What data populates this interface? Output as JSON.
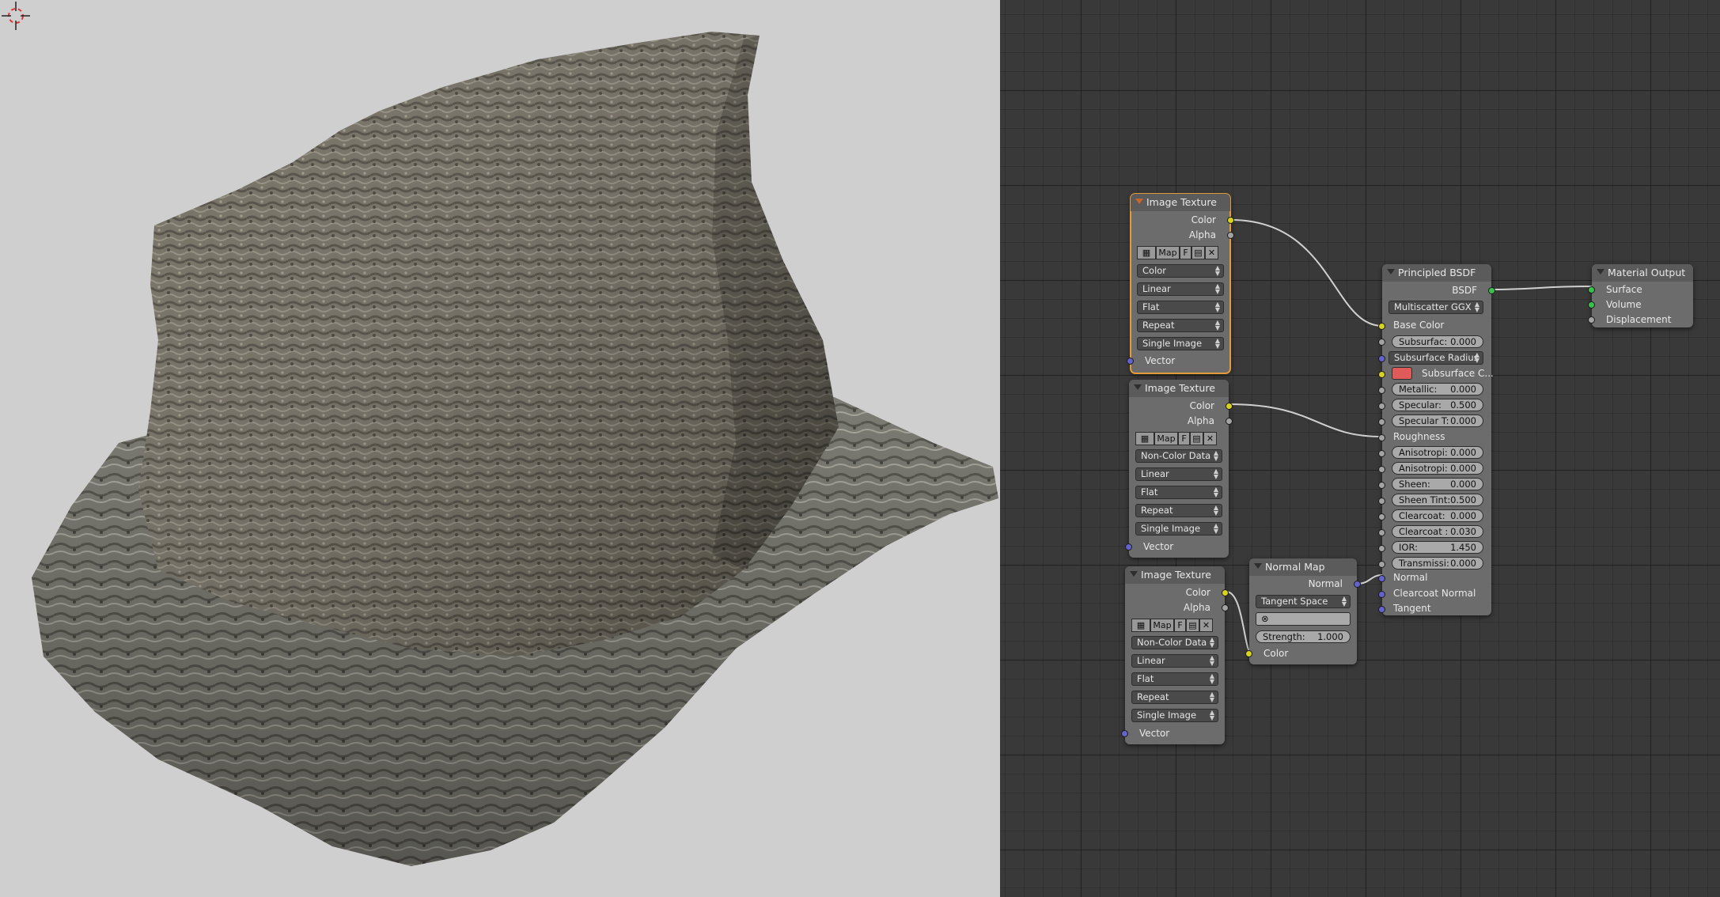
{
  "colors": {
    "viewport_bg": "#cfcfcf",
    "editor_bg": "#393939",
    "node_body": "#6c6c6c",
    "node_header": "#5b5b5b",
    "selected_outline": "#e29a3a",
    "socket_color": "#d8d31f",
    "socket_float": "#a3a3a3",
    "socket_vector": "#6363cc",
    "socket_shader": "#38c24b",
    "subsurface_color": "#e05a5a",
    "link": "#d0d0d0"
  },
  "viewport": {
    "object": "rock-scan-mesh",
    "cursor_icon": "3d-cursor-icon"
  },
  "nodes": {
    "image_texture_1": {
      "title": "Image Texture",
      "out_color": "Color",
      "out_alpha": "Alpha",
      "map_label": "Map",
      "fake_label": "F",
      "color_space": "Color",
      "interpolation": "Linear",
      "projection": "Flat",
      "extension": "Repeat",
      "source": "Single Image",
      "in_vector": "Vector"
    },
    "image_texture_2": {
      "title": "Image Texture",
      "out_color": "Color",
      "out_alpha": "Alpha",
      "map_label": "Map",
      "fake_label": "F",
      "color_space": "Non-Color Data",
      "interpolation": "Linear",
      "projection": "Flat",
      "extension": "Repeat",
      "source": "Single Image",
      "in_vector": "Vector"
    },
    "image_texture_3": {
      "title": "Image Texture",
      "out_color": "Color",
      "out_alpha": "Alpha",
      "map_label": "Map",
      "fake_label": "F",
      "color_space": "Non-Color Data",
      "interpolation": "Linear",
      "projection": "Flat",
      "extension": "Repeat",
      "source": "Single Image",
      "in_vector": "Vector"
    },
    "normal_map": {
      "title": "Normal Map",
      "out_normal": "Normal",
      "space": "Tangent Space",
      "strength_label": "Strength:",
      "strength_value": "1.000",
      "in_color": "Color"
    },
    "principled": {
      "title": "Principled BSDF",
      "out_bsdf": "BSDF",
      "distribution": "Multiscatter GGX",
      "base_color": "Base Color",
      "subsurface_label": "Subsurfac:",
      "subsurface_value": "0.000",
      "subsurface_radius": "Subsurface Radius",
      "subsurface_color": "Subsurface C...",
      "metallic_label": "Metallic:",
      "metallic_value": "0.000",
      "specular_label": "Specular:",
      "specular_value": "0.500",
      "specular_tint_label": "Specular T:",
      "specular_tint_value": "0.000",
      "roughness": "Roughness",
      "anisotropic_label": "Anisotropi:",
      "anisotropic_value": "0.000",
      "anisotropic_rot_label": "Anisotropi:",
      "anisotropic_rot_value": "0.000",
      "sheen_label": "Sheen:",
      "sheen_value": "0.000",
      "sheen_tint_label": "Sheen Tint:",
      "sheen_tint_value": "0.500",
      "clearcoat_label": "Clearcoat:",
      "clearcoat_value": "0.000",
      "clearcoat_rough_label": "Clearcoat :",
      "clearcoat_rough_value": "0.030",
      "ior_label": "IOR:",
      "ior_value": "1.450",
      "transmission_label": "Transmissi:",
      "transmission_value": "0.000",
      "normal": "Normal",
      "clearcoat_normal": "Clearcoat Normal",
      "tangent": "Tangent"
    },
    "material_output": {
      "title": "Material Output",
      "surface": "Surface",
      "volume": "Volume",
      "displacement": "Displacement"
    }
  }
}
